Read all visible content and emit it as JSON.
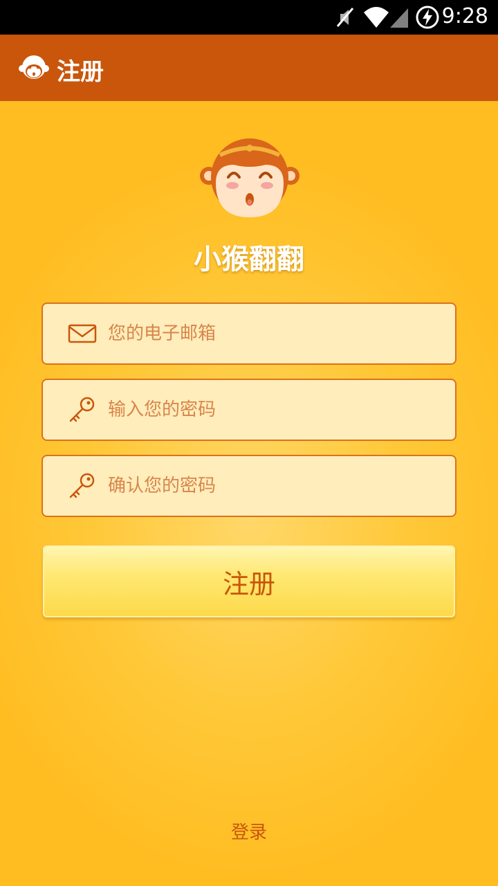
{
  "status_bar": {
    "time": "9:28",
    "icons": [
      "mute-icon",
      "wifi-icon",
      "signal-icon",
      "battery-charging-icon"
    ]
  },
  "action_bar": {
    "title": "注册",
    "icon": "monkey-logo-icon"
  },
  "brand": {
    "name": "小猴翻翻",
    "logo": "monkey-face-logo"
  },
  "form": {
    "email": {
      "placeholder": "您的电子邮箱",
      "value": "",
      "icon": "envelope-icon"
    },
    "password": {
      "placeholder": "输入您的密码",
      "value": "",
      "icon": "key-icon"
    },
    "confirm_password": {
      "placeholder": "确认您的密码",
      "value": "",
      "icon": "key-icon"
    },
    "submit_label": "注册"
  },
  "footer": {
    "login_label": "登录"
  },
  "colors": {
    "action_bar": "#c9560b",
    "background": "#ffc12a",
    "field_bg": "#ffedbb",
    "accent": "#c9560b"
  }
}
